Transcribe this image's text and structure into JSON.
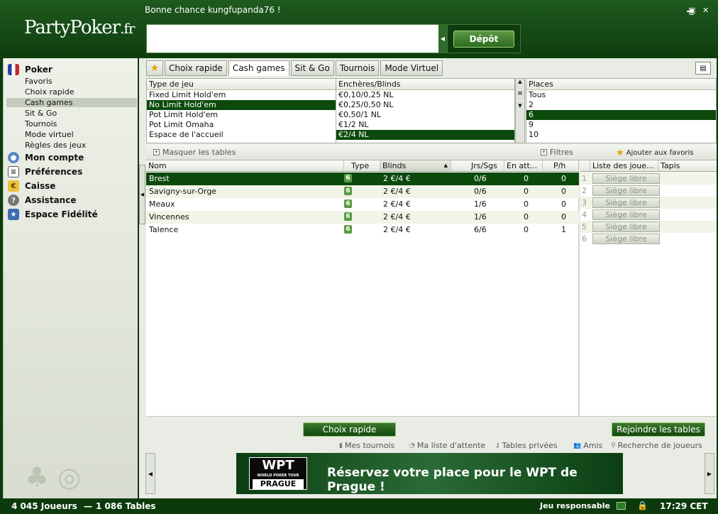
{
  "header": {
    "logo_main": "PartyPoker",
    "logo_suffix": ".fr",
    "greeting": "Bonne chance kungfupanda76 !",
    "deposit_label": "Dépôt"
  },
  "window": {
    "minimize": "_",
    "restore": "▣",
    "close": "✕"
  },
  "sidebar": {
    "sections": [
      {
        "label": "Poker"
      },
      {
        "label": "Mon compte"
      },
      {
        "label": "Préférences"
      },
      {
        "label": "Caisse"
      },
      {
        "label": "Assistance"
      },
      {
        "label": "Espace Fidélité"
      }
    ],
    "poker_items": [
      "Favoris",
      "Choix rapide",
      "Cash games",
      "Sit & Go",
      "Tournois",
      "Mode virtuel",
      "Règles des jeux"
    ],
    "selected_item": "Cash games"
  },
  "tabs": [
    "Choix rapide",
    "Cash games",
    "Sit & Go",
    "Tournois",
    "Mode Virtuel"
  ],
  "active_tab": "Cash games",
  "filters": {
    "game_type": {
      "header": "Type de jeu",
      "items": [
        "Fixed Limit Hold'em",
        "No Limit Hold'em",
        "Pot Limit Hold'em",
        "Pot Limit Omaha",
        "Espace de l'accueil"
      ],
      "selected": "No Limit Hold'em"
    },
    "blinds": {
      "header": "Enchères/Blinds",
      "items": [
        "€0,10/0,25 NL",
        "€0,25/0,50 NL",
        "€0,50/1 NL",
        "€1/2 NL",
        "€2/4 NL"
      ],
      "selected": "€2/4 NL"
    },
    "seats": {
      "header": "Places",
      "items": [
        "Tous",
        "2",
        "6",
        "9",
        "10"
      ],
      "selected": "6"
    }
  },
  "toolbar": {
    "hide_tables": "Masquer les tables",
    "filters": "Filtres",
    "add_favorites": "Ajouter aux favoris"
  },
  "table_list": {
    "columns": [
      "Nom",
      "Type",
      "Blinds",
      "Jrs/Sgs",
      "En att...",
      "P/h"
    ],
    "rows": [
      {
        "name": "Brest",
        "type": "6",
        "blinds": "2 €/4 €",
        "players": "0/6",
        "waiting": "0",
        "ph": "0"
      },
      {
        "name": "Savigny-sur-Orge",
        "type": "6",
        "blinds": "2 €/4 €",
        "players": "0/6",
        "waiting": "0",
        "ph": "0"
      },
      {
        "name": "Meaux",
        "type": "6",
        "blinds": "2 €/4 €",
        "players": "1/6",
        "waiting": "0",
        "ph": "0"
      },
      {
        "name": "Vincennes",
        "type": "6",
        "blinds": "2 €/4 €",
        "players": "1/6",
        "waiting": "0",
        "ph": "0"
      },
      {
        "name": "Talence",
        "type": "6",
        "blinds": "2 €/4 €",
        "players": "6/6",
        "waiting": "0",
        "ph": "1"
      }
    ],
    "selected_row": "Brest"
  },
  "player_list": {
    "columns": [
      "Liste des joue...",
      "Tapis"
    ],
    "seats": [
      {
        "num": "1",
        "label": "Siège libre"
      },
      {
        "num": "2",
        "label": "Siège libre"
      },
      {
        "num": "3",
        "label": "Siège libre"
      },
      {
        "num": "4",
        "label": "Siège libre"
      },
      {
        "num": "5",
        "label": "Siège libre"
      },
      {
        "num": "6",
        "label": "Siège libre"
      }
    ]
  },
  "bottom": {
    "quick_choice": "Choix rapide",
    "join_tables": "Rejoindre les tables",
    "links": [
      "Mes tournois",
      "Ma liste d'attente",
      "Tables privées",
      "Amis",
      "Recherche de joueurs"
    ]
  },
  "banner": {
    "logo_top": "WPT",
    "logo_mid": "WORLD POKER TOUR",
    "logo_bottom": "PRAGUE",
    "text": "Réservez votre place pour le WPT de Prague !"
  },
  "status": {
    "players": "4 045 Joueurs",
    "separator": "—",
    "tables": "1 086 Tables",
    "responsible": "Jeu responsable",
    "time": "17:29 CET"
  }
}
